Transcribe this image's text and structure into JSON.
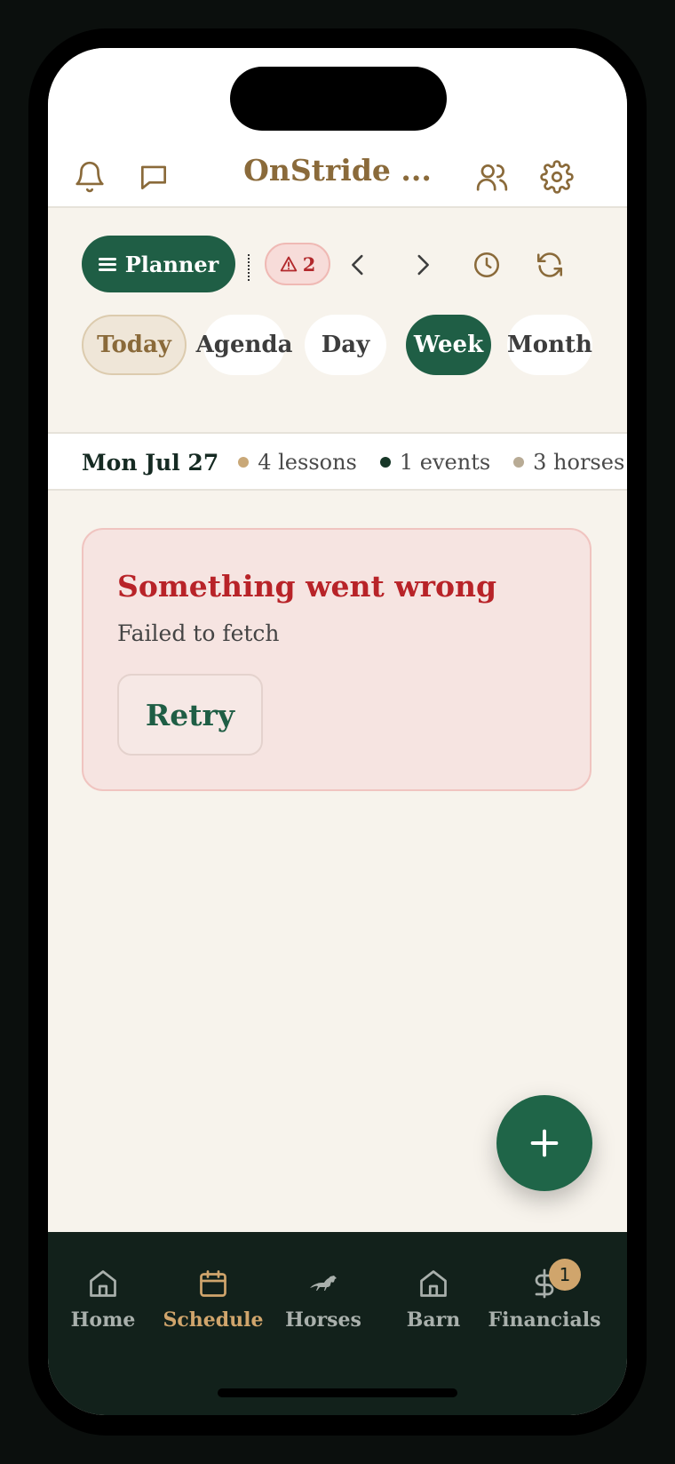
{
  "header": {
    "title": "OnStride ...",
    "icons": [
      "bell-icon",
      "chat-icon",
      "users-icon",
      "gear-icon"
    ]
  },
  "toolbar": {
    "planner_label": "Planner",
    "alert_count": "2",
    "icons": [
      "chevron-left-icon",
      "chevron-right-icon",
      "clock-icon",
      "refresh-icon"
    ]
  },
  "views": {
    "today": "Today",
    "agenda": "Agenda",
    "day": "Day",
    "week": "Week",
    "month": "Month",
    "active": "Week"
  },
  "summary": {
    "date": "Mon Jul 27",
    "lessons": "4 lessons",
    "events": "1 events",
    "horses": "3 horses"
  },
  "error": {
    "title": "Something went wrong",
    "message": "Failed to fetch",
    "retry_label": "Retry"
  },
  "nav": {
    "items": [
      {
        "label": "Home",
        "icon": "home-icon"
      },
      {
        "label": "Schedule",
        "icon": "calendar-icon"
      },
      {
        "label": "Horses",
        "icon": "horse-icon"
      },
      {
        "label": "Barn",
        "icon": "barn-icon"
      },
      {
        "label": "Financials",
        "icon": "dollar-icon",
        "badge": "1"
      }
    ],
    "active": "Schedule"
  },
  "colors": {
    "primary_green": "#1f5e45",
    "gold": "#8a6a3a",
    "error_red": "#b82328",
    "nav_bg": "#12211b",
    "background": "#f7f3ec"
  }
}
